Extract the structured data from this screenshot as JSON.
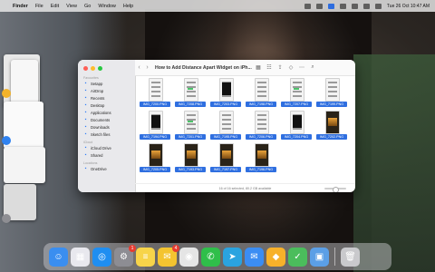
{
  "menubar": {
    "app_name": "Finder",
    "menus": [
      "File",
      "Edit",
      "View",
      "Go",
      "Window",
      "Help"
    ],
    "clock": "Tue 26 Oct  10:47 AM"
  },
  "finder": {
    "title": "How to Add Distance Apart Widget on iPh...",
    "sidebar": {
      "favourites_header": "Favourites",
      "favourites": [
        {
          "label": "Setapp",
          "icon": "setapp-icon"
        },
        {
          "label": "AirDrop",
          "icon": "airdrop-icon"
        },
        {
          "label": "Recents",
          "icon": "recents-icon"
        },
        {
          "label": "Desktop",
          "icon": "desktop-icon"
        },
        {
          "label": "Applications",
          "icon": "applications-icon"
        },
        {
          "label": "Documents",
          "icon": "documents-icon"
        },
        {
          "label": "Downloads",
          "icon": "downloads-icon"
        },
        {
          "label": "Sketch files",
          "icon": "folder-icon"
        }
      ],
      "icloud_header": "iCloud",
      "icloud": [
        {
          "label": "iCloud Drive",
          "icon": "icloud-icon"
        },
        {
          "label": "Shared",
          "icon": "shared-icon"
        }
      ],
      "locations_header": "Locations",
      "locations": [
        {
          "label": "OneDrive",
          "icon": "onedrive-icon"
        }
      ]
    },
    "files": [
      {
        "name": "IMG_7200.PNG",
        "style": "light"
      },
      {
        "name": "IMG_7208.PNG",
        "style": "light"
      },
      {
        "name": "IMG_7203.PNG",
        "style": "light"
      },
      {
        "name": "IMG_7198.PNG",
        "style": "light"
      },
      {
        "name": "IMG_7207.PNG",
        "style": "light"
      },
      {
        "name": "IMG_7199.PNG",
        "style": "light"
      },
      {
        "name": "IMG_7194.PNG",
        "style": "light"
      },
      {
        "name": "IMG_7201.PNG",
        "style": "light"
      },
      {
        "name": "IMG_7195.PNG",
        "style": "light"
      },
      {
        "name": "IMG_7206.PNG",
        "style": "light"
      },
      {
        "name": "IMG_7204.PNG",
        "style": "light"
      },
      {
        "name": "IMG_7202.PNG",
        "style": "dark"
      },
      {
        "name": "IMG_7205.PNG",
        "style": "dark"
      },
      {
        "name": "IMG_7193.PNG",
        "style": "dark"
      },
      {
        "name": "IMG_7197.PNG",
        "style": "dark"
      },
      {
        "name": "IMG_7196.PNG",
        "style": "dark"
      }
    ],
    "status": "16 of 16 selected, 80.2 GB available"
  },
  "dock": {
    "apps": [
      {
        "name": "finder-icon",
        "color": "#3a8ef0",
        "glyph": "☺"
      },
      {
        "name": "launchpad-icon",
        "color": "#e8e8ee",
        "glyph": "▦"
      },
      {
        "name": "safari-icon",
        "color": "#1f8ef1",
        "glyph": "◎"
      },
      {
        "name": "system-preferences-icon",
        "color": "#8d8d93",
        "glyph": "⚙",
        "badge": "1"
      },
      {
        "name": "notes-icon",
        "color": "#f7d44a",
        "glyph": "≡"
      },
      {
        "name": "mail-app-icon",
        "color": "#f4c430",
        "glyph": "✉",
        "badge": "4"
      },
      {
        "name": "chrome-icon",
        "color": "#e5e5e5",
        "glyph": "◉"
      },
      {
        "name": "whatsapp-icon",
        "color": "#2fbf4a",
        "glyph": "✆"
      },
      {
        "name": "telegram-icon",
        "color": "#2aa3e0",
        "glyph": "➤"
      },
      {
        "name": "mail-icon",
        "color": "#3b8df3",
        "glyph": "✉"
      },
      {
        "name": "sketch-icon",
        "color": "#f7b12a",
        "glyph": "◆"
      },
      {
        "name": "adguard-icon",
        "color": "#4bbd5c",
        "glyph": "✓"
      },
      {
        "name": "preview-icon",
        "color": "#5b9fe6",
        "glyph": "▣"
      },
      {
        "name": "trash-icon",
        "color": "#c9c9cc",
        "glyph": "🗑"
      }
    ]
  }
}
